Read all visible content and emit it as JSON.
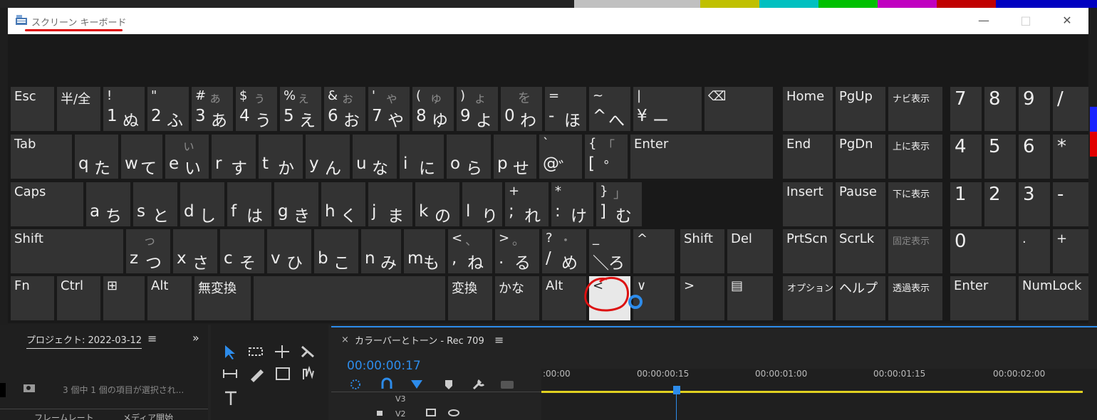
{
  "window": {
    "title": "スクリーン キーボード",
    "icon": "keyboard-icon",
    "minimize": "—",
    "maximize": "□",
    "close": "✕"
  },
  "keyboard": {
    "row1": [
      {
        "t": "Esc"
      },
      {
        "t": "半/全"
      },
      {
        "a": "!",
        "b": "",
        "c": "1",
        "d": "ぬ"
      },
      {
        "a": "\"",
        "b": "",
        "c": "2",
        "d": "ふ"
      },
      {
        "a": "#",
        "b": "ぁ",
        "c": "3",
        "d": "あ"
      },
      {
        "a": "$",
        "b": "ぅ",
        "c": "4",
        "d": "う"
      },
      {
        "a": "%",
        "b": "ぇ",
        "c": "5",
        "d": "え"
      },
      {
        "a": "&",
        "b": "ぉ",
        "c": "6",
        "d": "お"
      },
      {
        "a": "'",
        "b": "ゃ",
        "c": "7",
        "d": "や"
      },
      {
        "a": "(",
        "b": "ゅ",
        "c": "8",
        "d": "ゆ"
      },
      {
        "a": ")",
        "b": "ょ",
        "c": "9",
        "d": "よ"
      },
      {
        "a": "",
        "b": "を",
        "c": "0",
        "d": "わ"
      },
      {
        "a": "=",
        "b": "",
        "c": "-",
        "d": "ほ"
      },
      {
        "a": "~",
        "b": "",
        "c": "^",
        "d": "へ"
      },
      {
        "a": "|",
        "b": "",
        "c": "¥",
        "d": "ー"
      },
      {
        "t": "⌫"
      }
    ],
    "row2": [
      {
        "t": "Tab"
      },
      {
        "c": "q",
        "d": "た"
      },
      {
        "c": "w",
        "d": "て"
      },
      {
        "c": "e",
        "b": "ぃ",
        "d": "い"
      },
      {
        "c": "r",
        "d": "す"
      },
      {
        "c": "t",
        "d": "か"
      },
      {
        "c": "y",
        "d": "ん"
      },
      {
        "c": "u",
        "d": "な"
      },
      {
        "c": "i",
        "d": "に"
      },
      {
        "c": "o",
        "d": "ら"
      },
      {
        "c": "p",
        "d": "せ"
      },
      {
        "a": "`",
        "c": "@",
        "d": "゛"
      },
      {
        "a": "{",
        "b": "「",
        "c": "[",
        "d": "゜"
      },
      {
        "t": "Enter"
      }
    ],
    "row3": [
      {
        "t": "Caps"
      },
      {
        "c": "a",
        "d": "ち"
      },
      {
        "c": "s",
        "d": "と"
      },
      {
        "c": "d",
        "d": "し"
      },
      {
        "c": "f",
        "d": "は"
      },
      {
        "c": "g",
        "d": "き"
      },
      {
        "c": "h",
        "d": "く"
      },
      {
        "c": "j",
        "d": "ま"
      },
      {
        "c": "k",
        "d": "の"
      },
      {
        "c": "l",
        "d": "り"
      },
      {
        "a": "+",
        "c": ";",
        "d": "れ"
      },
      {
        "a": "*",
        "c": ":",
        "d": "け"
      },
      {
        "a": "}",
        "b": "」",
        "c": "]",
        "d": "む"
      }
    ],
    "row4": [
      {
        "t": "Shift"
      },
      {
        "c": "z",
        "b": "っ",
        "d": "つ"
      },
      {
        "c": "x",
        "d": "さ"
      },
      {
        "c": "c",
        "d": "そ"
      },
      {
        "c": "v",
        "d": "ひ"
      },
      {
        "c": "b",
        "d": "こ"
      },
      {
        "c": "n",
        "d": "み"
      },
      {
        "c": "m",
        "d": "も"
      },
      {
        "a": "<",
        "b": "、",
        "c": ",",
        "d": "ね"
      },
      {
        "a": ">",
        "b": "。",
        "c": ".",
        "d": "る"
      },
      {
        "a": "?",
        "b": "・",
        "c": "/",
        "d": "め"
      },
      {
        "a": "_",
        "c": "＼",
        "d": "ろ"
      },
      {
        "t": "^"
      },
      {
        "t": "Shift"
      },
      {
        "t": "Del"
      }
    ],
    "row5": [
      {
        "t": "Fn"
      },
      {
        "t": "Ctrl"
      },
      {
        "t": "⊞"
      },
      {
        "t": "Alt"
      },
      {
        "t": "無変換"
      },
      {
        "t": ""
      },
      {
        "t": "変換"
      },
      {
        "t": "かな"
      },
      {
        "t": "Alt"
      },
      {
        "t": "<"
      },
      {
        "t": "∨"
      },
      {
        "t": ">"
      },
      {
        "t": "▤"
      }
    ],
    "nav": [
      "Home",
      "PgUp",
      "ナビ表示",
      "End",
      "PgDn",
      "上に表示",
      "Insert",
      "Pause",
      "下に表示",
      "PrtScn",
      "ScrLk",
      "固定表示",
      "オプション",
      "ヘルプ",
      "透過表示"
    ],
    "numpad": [
      "7",
      "8",
      "9",
      "/",
      "4",
      "5",
      "6",
      "*",
      "1",
      "2",
      "3",
      "-",
      "0",
      ".",
      "+",
      "Enter",
      "NumLock"
    ]
  },
  "premiere": {
    "project_label": "プロジェクト: 2022-03-12",
    "menu_icon": "≡",
    "expand": "»",
    "selection_info": "3 個中 1 個の項目が選択され...",
    "col_framerate": "フレームレート",
    "col_media": "メディア開始",
    "sequence_title": "カラーバーとトーン - Rec 709",
    "timecode": "00:00:00:17",
    "ruler": [
      ":00:00",
      "00:00:00:15",
      "00:00:01:00",
      "00:00:01:15",
      "00:00:02:00"
    ],
    "tracks": [
      "V3",
      "V2"
    ],
    "close": "×"
  },
  "colors": {
    "accent": "#2d8ceb",
    "key_bg": "#333333",
    "sel_key": "#e8e8e8",
    "annotation": "#dd1111",
    "timeline_yellow": "#e0d020"
  }
}
